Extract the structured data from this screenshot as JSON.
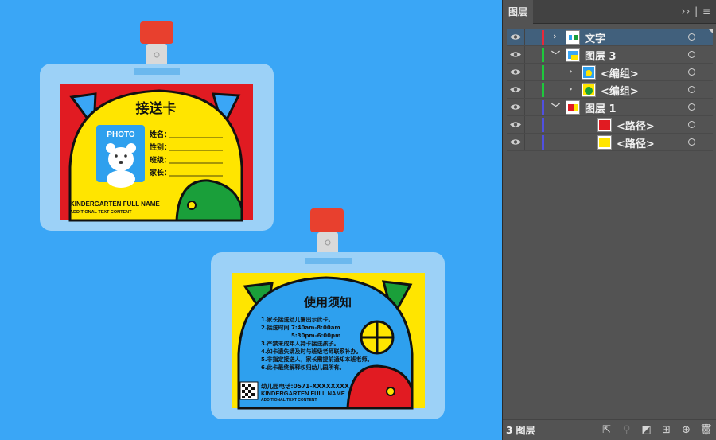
{
  "canvas": {
    "front_card": {
      "title": "接送卡",
      "photo_label": "PHOTO",
      "fields": [
        "姓名：",
        "性别：",
        "班级：",
        "家长："
      ],
      "footer_main": "KINDERGARTEN FULL NAME",
      "footer_sub": "ADDITIONAL TEXT CONTENT"
    },
    "back_card": {
      "title": "使用须知",
      "rules": [
        "1.家长接送幼儿需出示此卡。",
        "2.接送时间  7:40am-8:00am",
        "5:30pm-6:00pm",
        "3.严禁未成年人持卡接送孩子。",
        "4.如卡遗失请及时与班级老师联系补办。",
        "5.非指定接送人，家长需提前通知本班老师。",
        "6.此卡最终解释权归幼儿园所有。"
      ],
      "phone": "幼儿园电话:0571-XXXXXXXX",
      "footer_main": "KINDERGARTEN FULL NAME",
      "footer_sub": "ADDITIONAL TEXT CONTENT"
    }
  },
  "panel": {
    "tab_label": "图层",
    "menu_glyphs": "›› | ≡",
    "layers": [
      {
        "name": "文字",
        "color": "#e8283a",
        "indent": 0,
        "expanded": false,
        "selected": true
      },
      {
        "name": "图层 3",
        "color": "#1ec83c",
        "indent": 0,
        "expanded": true,
        "selected": false
      },
      {
        "name": "<编组>",
        "color": "#1ec83c",
        "indent": 1,
        "expanded": false,
        "selected": false
      },
      {
        "name": "<编组>",
        "color": "#1ec83c",
        "indent": 1,
        "expanded": false,
        "selected": false
      },
      {
        "name": "图层 1",
        "color": "#5050e0",
        "indent": 0,
        "expanded": true,
        "selected": false
      },
      {
        "name": "<路径>",
        "color": "#5050e0",
        "indent": 2,
        "expanded": null,
        "selected": false
      },
      {
        "name": "<路径>",
        "color": "#5050e0",
        "indent": 2,
        "expanded": null,
        "selected": false
      }
    ],
    "footer_count": "3 图层",
    "footer_icons": [
      "export-icon",
      "locate-icon",
      "clipping-mask-icon",
      "new-sublayer-icon",
      "new-layer-icon",
      "trash-icon"
    ]
  }
}
